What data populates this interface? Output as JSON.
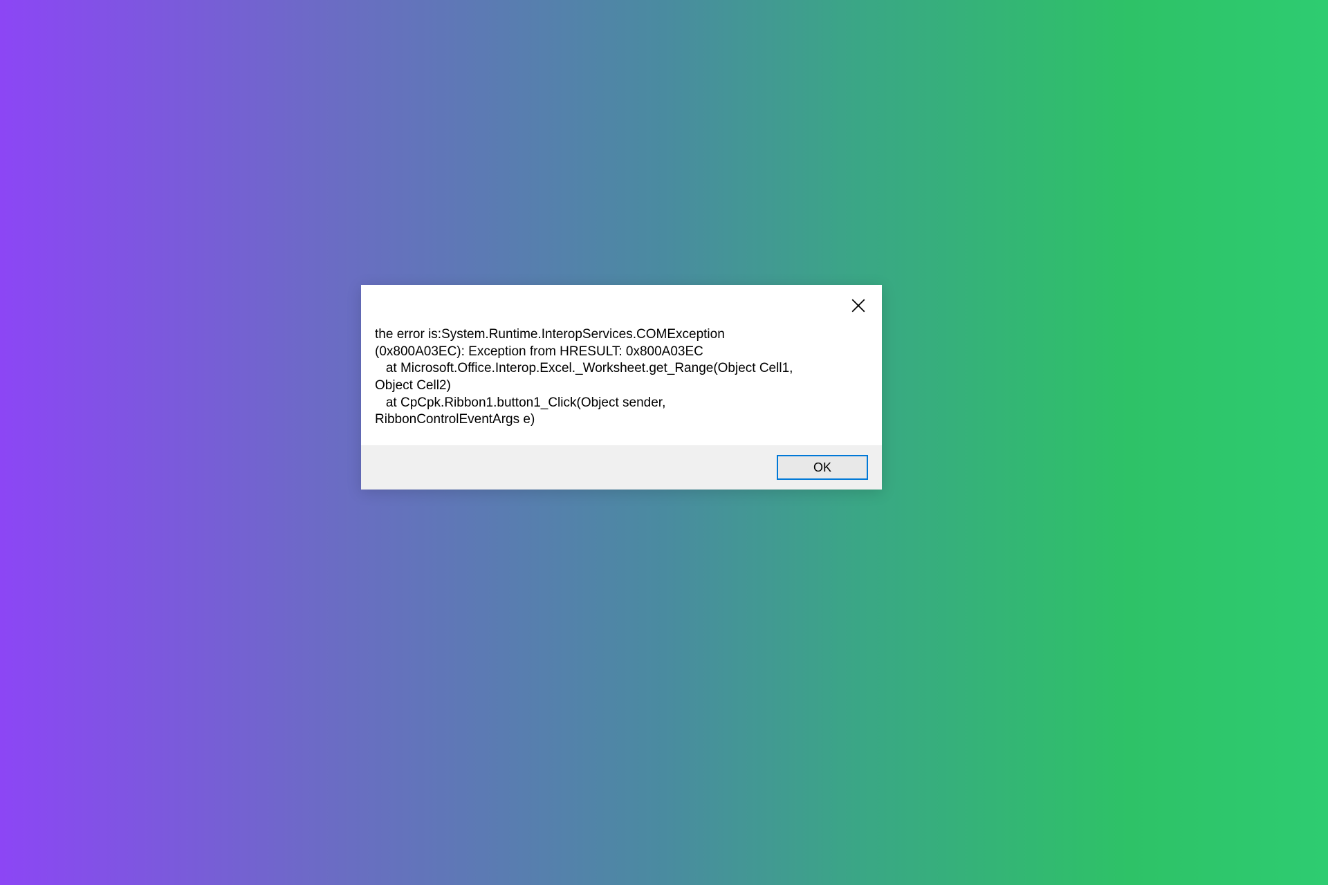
{
  "dialog": {
    "message_lines": [
      "the error is:System.Runtime.InteropServices.COMException",
      "(0x800A03EC): Exception from HRESULT: 0x800A03EC",
      "   at Microsoft.Office.Interop.Excel._Worksheet.get_Range(Object Cell1,",
      "Object Cell2)",
      "   at CpCpk.Ribbon1.button1_Click(Object sender,",
      "RibbonControlEventArgs e)"
    ],
    "ok_label": "OK"
  }
}
